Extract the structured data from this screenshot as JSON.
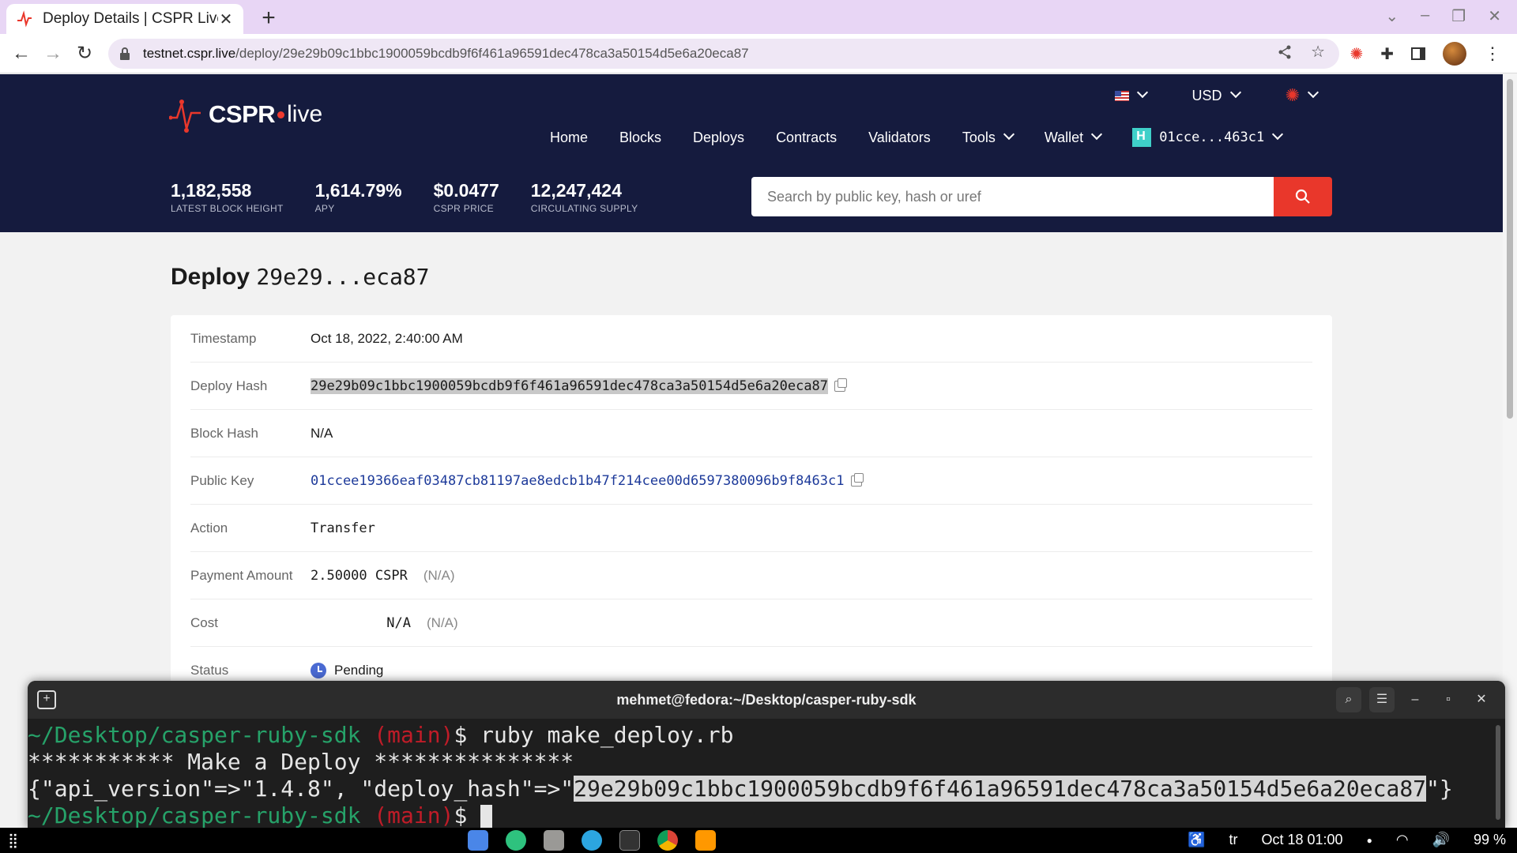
{
  "browser": {
    "tab_title": "Deploy Details | CSPR Live",
    "url_domain": "testnet.cspr.live",
    "url_path": "/deploy/29e29b09c1bbc1900059bcdb9f6f461a96591dec478ca3a50154d5e6a20eca87"
  },
  "header": {
    "logo_text": "CSPR",
    "logo_suffix": "live",
    "currency": "USD",
    "nav": [
      "Home",
      "Blocks",
      "Deploys",
      "Contracts",
      "Validators",
      "Tools",
      "Wallet"
    ],
    "account": "01cce...463c1",
    "stats": [
      {
        "value": "1,182,558",
        "label": "LATEST BLOCK HEIGHT"
      },
      {
        "value": "1,614.79%",
        "label": "APY"
      },
      {
        "value": "$0.0477",
        "label": "CSPR PRICE"
      },
      {
        "value": "12,247,424",
        "label": "CIRCULATING SUPPLY"
      }
    ],
    "search_placeholder": "Search by public key, hash or uref"
  },
  "deploy": {
    "title_word": "Deploy",
    "title_hash": "29e29...eca87",
    "rows": [
      {
        "key": "Timestamp",
        "value": "Oct 18, 2022, 2:40:00 AM"
      },
      {
        "key": "Deploy Hash",
        "value": "29e29b09c1bbc1900059bcdb9f6f461a96591dec478ca3a50154d5e6a20eca87"
      },
      {
        "key": "Block Hash",
        "value": "N/A"
      },
      {
        "key": "Public Key",
        "value": "01ccee19366eaf03487cb81197ae8edcb1b47f214cee00d6597380096b9f8463c1"
      },
      {
        "key": "Action",
        "value": "Transfer"
      },
      {
        "key": "Payment Amount",
        "value": "2.50000 CSPR",
        "extra": "(N/A)"
      },
      {
        "key": "Cost",
        "value": "N/A",
        "extra": "(N/A)"
      },
      {
        "key": "Status",
        "value": "Pending"
      }
    ]
  },
  "terminal": {
    "title": "mehmet@fedora:~/Desktop/casper-ruby-sdk",
    "path": "~/Desktop/casper-ruby-sdk",
    "branch": "(main)",
    "command": "ruby make_deploy.rb",
    "line2": "*********** Make a Deploy ***************",
    "line3_prefix": "{\"api_version\"=>\"1.4.8\", \"deploy_hash\"=>\"",
    "line3_hash": "29e29b09c1bbc1900059bcdb9f6f461a96591dec478ca3a50154d5e6a20eca87",
    "line3_suffix": "\"}"
  },
  "taskbar": {
    "lang": "tr",
    "datetime": "Oct 18  01:00",
    "battery": "99 %"
  }
}
